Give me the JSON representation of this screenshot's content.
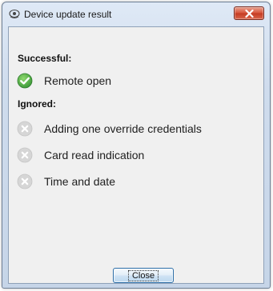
{
  "window": {
    "title": "Device update result"
  },
  "sections": {
    "successful": {
      "heading": "Successful:",
      "items": [
        {
          "label": "Remote open",
          "status_icon": "success-check-icon"
        }
      ]
    },
    "ignored": {
      "heading": "Ignored:",
      "items": [
        {
          "label": "Adding one override credentials",
          "status_icon": "ignored-x-icon"
        },
        {
          "label": "Card read indication",
          "status_icon": "ignored-x-icon"
        },
        {
          "label": "Time and date",
          "status_icon": "ignored-x-icon"
        }
      ]
    }
  },
  "buttons": {
    "close_label": "Close"
  },
  "colors": {
    "success": "#3e9a3a",
    "ignored": "#d4d4d4",
    "titlebar_close": "#c43b22"
  }
}
